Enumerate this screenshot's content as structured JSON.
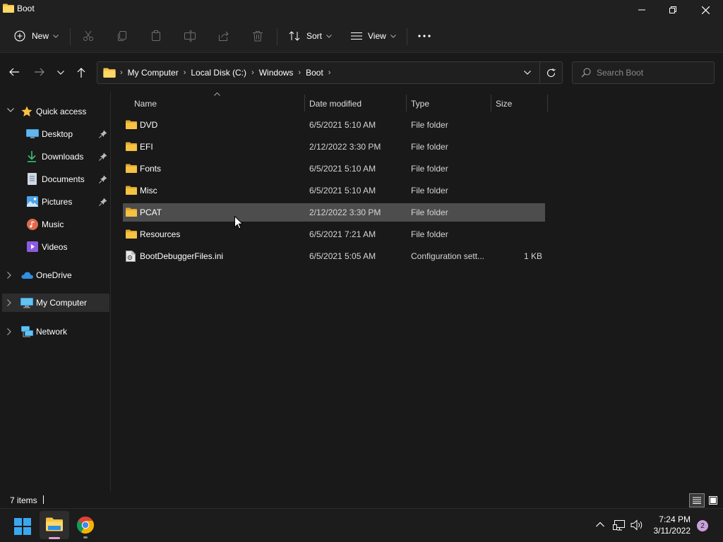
{
  "window": {
    "title": "Boot"
  },
  "toolbar": {
    "new_label": "New",
    "sort_label": "Sort",
    "view_label": "View"
  },
  "address": {
    "crumbs": [
      "My Computer",
      "Local Disk (C:)",
      "Windows",
      "Boot"
    ]
  },
  "search": {
    "placeholder": "Search Boot"
  },
  "sidebar": {
    "quick_access": "Quick access",
    "items": [
      {
        "label": "Desktop",
        "icon": "desktop-icon",
        "pinned": true
      },
      {
        "label": "Downloads",
        "icon": "downloads-icon",
        "pinned": true
      },
      {
        "label": "Documents",
        "icon": "documents-icon",
        "pinned": true
      },
      {
        "label": "Pictures",
        "icon": "pictures-icon",
        "pinned": true
      },
      {
        "label": "Music",
        "icon": "music-icon",
        "pinned": false
      },
      {
        "label": "Videos",
        "icon": "videos-icon",
        "pinned": false
      }
    ],
    "onedrive": "OneDrive",
    "my_computer": "My Computer",
    "network": "Network"
  },
  "columns": {
    "name": "Name",
    "date": "Date modified",
    "type": "Type",
    "size": "Size"
  },
  "files": [
    {
      "name": "DVD",
      "date": "6/5/2021 5:10 AM",
      "type": "File folder",
      "size": "",
      "kind": "folder"
    },
    {
      "name": "EFI",
      "date": "2/12/2022 3:30 PM",
      "type": "File folder",
      "size": "",
      "kind": "folder"
    },
    {
      "name": "Fonts",
      "date": "6/5/2021 5:10 AM",
      "type": "File folder",
      "size": "",
      "kind": "folder"
    },
    {
      "name": "Misc",
      "date": "6/5/2021 5:10 AM",
      "type": "File folder",
      "size": "",
      "kind": "folder"
    },
    {
      "name": "PCAT",
      "date": "2/12/2022 3:30 PM",
      "type": "File folder",
      "size": "",
      "kind": "folder",
      "selected": true
    },
    {
      "name": "Resources",
      "date": "6/5/2021 7:21 AM",
      "type": "File folder",
      "size": "",
      "kind": "folder"
    },
    {
      "name": "BootDebuggerFiles.ini",
      "date": "6/5/2021 5:05 AM",
      "type": "Configuration sett...",
      "size": "1 KB",
      "kind": "file"
    }
  ],
  "status": {
    "count": "7 items"
  },
  "taskbar": {
    "time": "7:24 PM",
    "date": "3/11/2022",
    "notifications": "2"
  },
  "colors": {
    "folder": "#f5c242",
    "accent": "#0078d4",
    "selection": "#4d4d4d"
  }
}
